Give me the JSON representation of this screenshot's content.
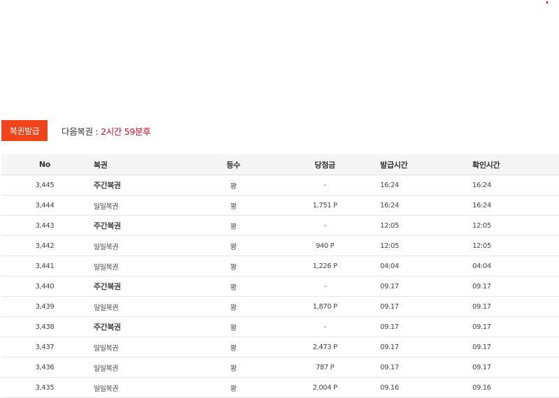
{
  "toolbar": {
    "issue_button_label": "복권발급",
    "next_label": "다음복권 : ",
    "next_value": "2시간 59분후"
  },
  "colors": {
    "accent": "#f0451c",
    "countdown": "#e8001c"
  },
  "table": {
    "headers": {
      "no": "No",
      "ticket": "복권",
      "grade": "등수",
      "prize": "당첨금",
      "issued": "발급시간",
      "checked": "확인시간"
    },
    "rows": [
      {
        "no": "3,445",
        "ticket": "주간복권",
        "weekly": true,
        "grade": "꽝",
        "prize": "-",
        "issued": "16:24",
        "checked": "16:24"
      },
      {
        "no": "3,444",
        "ticket": "일일복권",
        "weekly": false,
        "grade": "꽝",
        "prize": "1,751 P",
        "issued": "16:24",
        "checked": "16:24"
      },
      {
        "no": "3,443",
        "ticket": "주간복권",
        "weekly": true,
        "grade": "꽝",
        "prize": "-",
        "issued": "12:05",
        "checked": "12:05"
      },
      {
        "no": "3,442",
        "ticket": "일일복권",
        "weekly": false,
        "grade": "꽝",
        "prize": "940 P",
        "issued": "12:05",
        "checked": "12:05"
      },
      {
        "no": "3,441",
        "ticket": "일일복권",
        "weekly": false,
        "grade": "꽝",
        "prize": "1,226 P",
        "issued": "04:04",
        "checked": "04:04"
      },
      {
        "no": "3,440",
        "ticket": "주간복권",
        "weekly": true,
        "grade": "꽝",
        "prize": "-",
        "issued": "09.17",
        "checked": "09.17"
      },
      {
        "no": "3,439",
        "ticket": "일일복권",
        "weekly": false,
        "grade": "꽝",
        "prize": "1,870 P",
        "issued": "09.17",
        "checked": "09.17"
      },
      {
        "no": "3,438",
        "ticket": "주간복권",
        "weekly": true,
        "grade": "꽝",
        "prize": "-",
        "issued": "09.17",
        "checked": "09.17"
      },
      {
        "no": "3,437",
        "ticket": "일일복권",
        "weekly": false,
        "grade": "꽝",
        "prize": "2,473 P",
        "issued": "09.17",
        "checked": "09.17"
      },
      {
        "no": "3,436",
        "ticket": "일일복권",
        "weekly": false,
        "grade": "꽝",
        "prize": "787 P",
        "issued": "09.17",
        "checked": "09.17"
      },
      {
        "no": "3,435",
        "ticket": "일일복권",
        "weekly": false,
        "grade": "꽝",
        "prize": "2,004 P",
        "issued": "09.16",
        "checked": "09.16"
      }
    ]
  }
}
